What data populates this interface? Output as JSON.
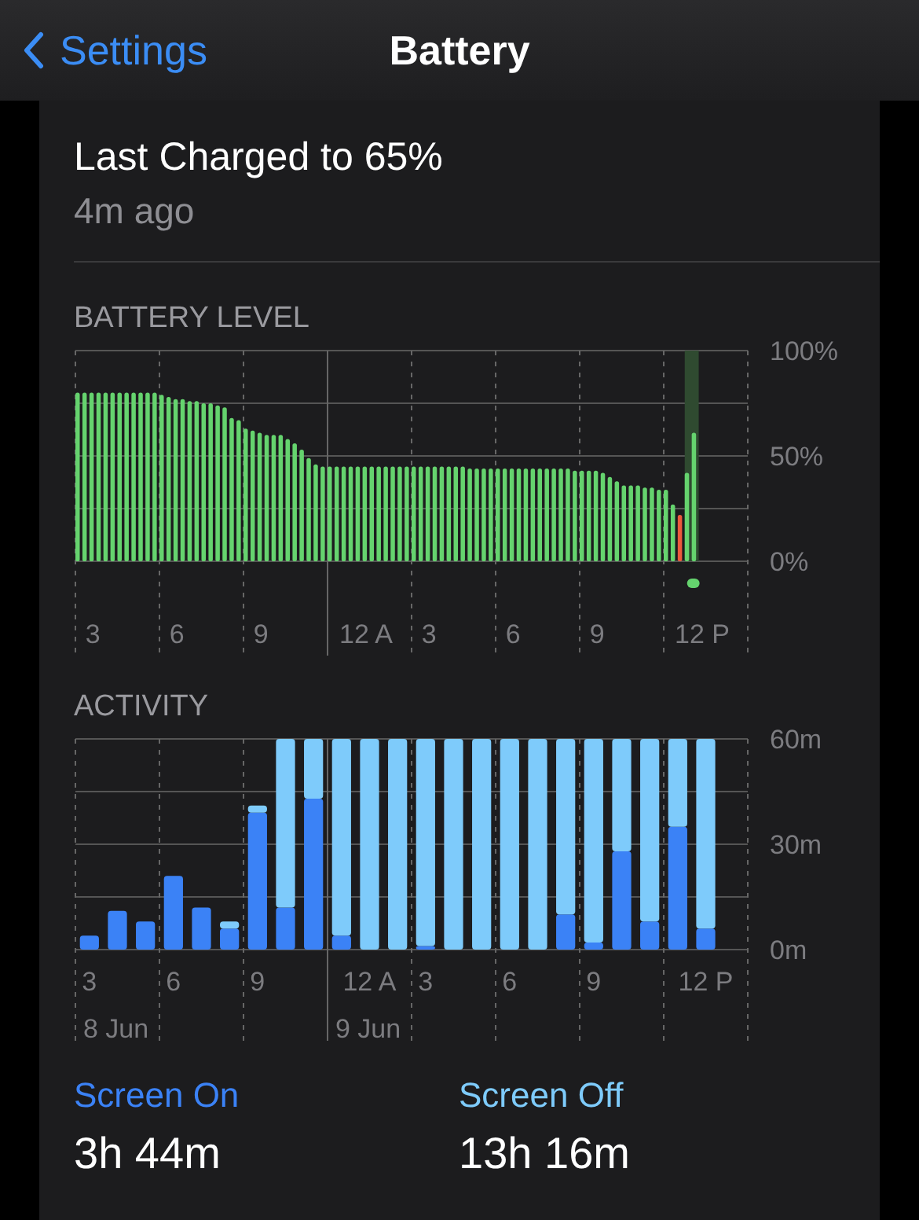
{
  "nav": {
    "back": "Settings",
    "title": "Battery"
  },
  "last_charged": {
    "title": "Last Charged to 65%",
    "time": "4m ago"
  },
  "battery_level": {
    "heading": "BATTERY LEVEL",
    "chart_data": {
      "type": "bar",
      "ylim": [
        0,
        100
      ],
      "categories": [
        null,
        null,
        "3",
        null,
        null,
        null,
        null,
        null,
        null,
        null,
        null,
        null,
        null,
        null,
        "6",
        null,
        null,
        null,
        null,
        null,
        null,
        null,
        null,
        null,
        null,
        null,
        "9",
        null,
        null,
        null,
        null,
        null,
        null,
        null,
        null,
        null,
        null,
        null,
        null,
        null,
        null,
        "12 A",
        null,
        null,
        null,
        null,
        null,
        null,
        null,
        null,
        "3",
        null,
        null,
        null,
        null,
        null,
        null,
        null,
        null,
        null,
        null,
        null,
        "6",
        null,
        null,
        null,
        null,
        null,
        null,
        null,
        null,
        null,
        null,
        null,
        "9",
        null,
        null,
        null,
        null,
        null,
        null,
        null,
        null,
        null,
        null,
        null,
        null,
        null,
        null,
        "12 P",
        null,
        null,
        null,
        null,
        null,
        null
      ],
      "yticks": [
        {
          "value": 0,
          "label": "0%"
        },
        {
          "value": 50,
          "label": "50%"
        },
        {
          "value": 100,
          "label": "100%"
        }
      ],
      "series": [
        {
          "color": "#65d36e",
          "values": [
            80,
            80,
            80,
            80,
            80,
            80,
            80,
            80,
            80,
            80,
            80,
            80,
            79,
            78,
            77,
            77,
            76,
            76,
            75,
            75,
            74,
            73,
            68,
            67,
            63,
            62,
            61,
            60,
            60,
            60,
            58,
            56,
            53,
            49,
            46,
            45,
            45,
            45,
            45,
            45,
            45,
            45,
            45,
            45,
            45,
            45,
            45,
            45,
            45,
            45,
            45,
            45,
            45,
            45,
            45,
            45,
            44,
            44,
            44,
            44,
            44,
            44,
            44,
            44,
            44,
            44,
            44,
            44,
            44,
            44,
            44,
            43,
            43,
            43,
            43,
            42,
            40,
            38,
            36,
            36,
            36,
            35,
            35,
            34,
            34,
            27,
            null,
            42,
            61,
            null,
            null,
            null,
            null,
            null,
            null,
            null
          ]
        },
        {
          "color": "#eb5a3c",
          "values": [
            null,
            null,
            null,
            null,
            null,
            null,
            null,
            null,
            null,
            null,
            null,
            null,
            null,
            null,
            null,
            null,
            null,
            null,
            null,
            null,
            null,
            null,
            null,
            null,
            null,
            null,
            null,
            null,
            null,
            null,
            null,
            null,
            null,
            null,
            null,
            null,
            null,
            null,
            null,
            null,
            null,
            null,
            null,
            null,
            null,
            null,
            null,
            null,
            null,
            null,
            null,
            null,
            null,
            null,
            null,
            null,
            null,
            null,
            null,
            null,
            null,
            null,
            null,
            null,
            null,
            null,
            null,
            null,
            null,
            null,
            null,
            null,
            null,
            null,
            null,
            null,
            null,
            null,
            null,
            null,
            null,
            null,
            null,
            null,
            null,
            null,
            22,
            null,
            null,
            null,
            null,
            null,
            null,
            null,
            null,
            null
          ]
        }
      ]
    }
  },
  "activity": {
    "heading": "ACTIVITY",
    "dates": [
      "8 Jun",
      "9 Jun"
    ],
    "chart_data": {
      "type": "bar",
      "stacked": true,
      "ylim": [
        0,
        60
      ],
      "categories": [
        "3",
        null,
        null,
        "6",
        null,
        null,
        "9",
        null,
        null,
        null,
        "12 A",
        null,
        "3",
        null,
        null,
        "6",
        null,
        null,
        "9",
        null,
        null,
        null,
        "12 P",
        null
      ],
      "yticks": [
        {
          "value": 0,
          "label": "0m"
        },
        {
          "value": 30,
          "label": "30m"
        },
        {
          "value": 60,
          "label": "60m"
        }
      ],
      "series": [
        {
          "name": "Screen On",
          "color": "#3b82f6",
          "values": [
            4,
            11,
            8,
            21,
            12,
            6,
            39,
            12,
            43,
            4,
            0,
            0,
            1,
            0,
            0,
            0,
            0,
            10,
            2,
            28,
            8,
            35,
            6,
            null
          ]
        },
        {
          "name": "Screen Off",
          "color": "#7ecbfb",
          "values": [
            0,
            0,
            0,
            0,
            0,
            2,
            2,
            48,
            17,
            56,
            60,
            60,
            59,
            60,
            60,
            60,
            60,
            50,
            58,
            32,
            52,
            25,
            54,
            null
          ]
        }
      ]
    }
  },
  "totals": [
    {
      "value": "3h 44m"
    },
    {
      "value": "13h 16m"
    }
  ]
}
